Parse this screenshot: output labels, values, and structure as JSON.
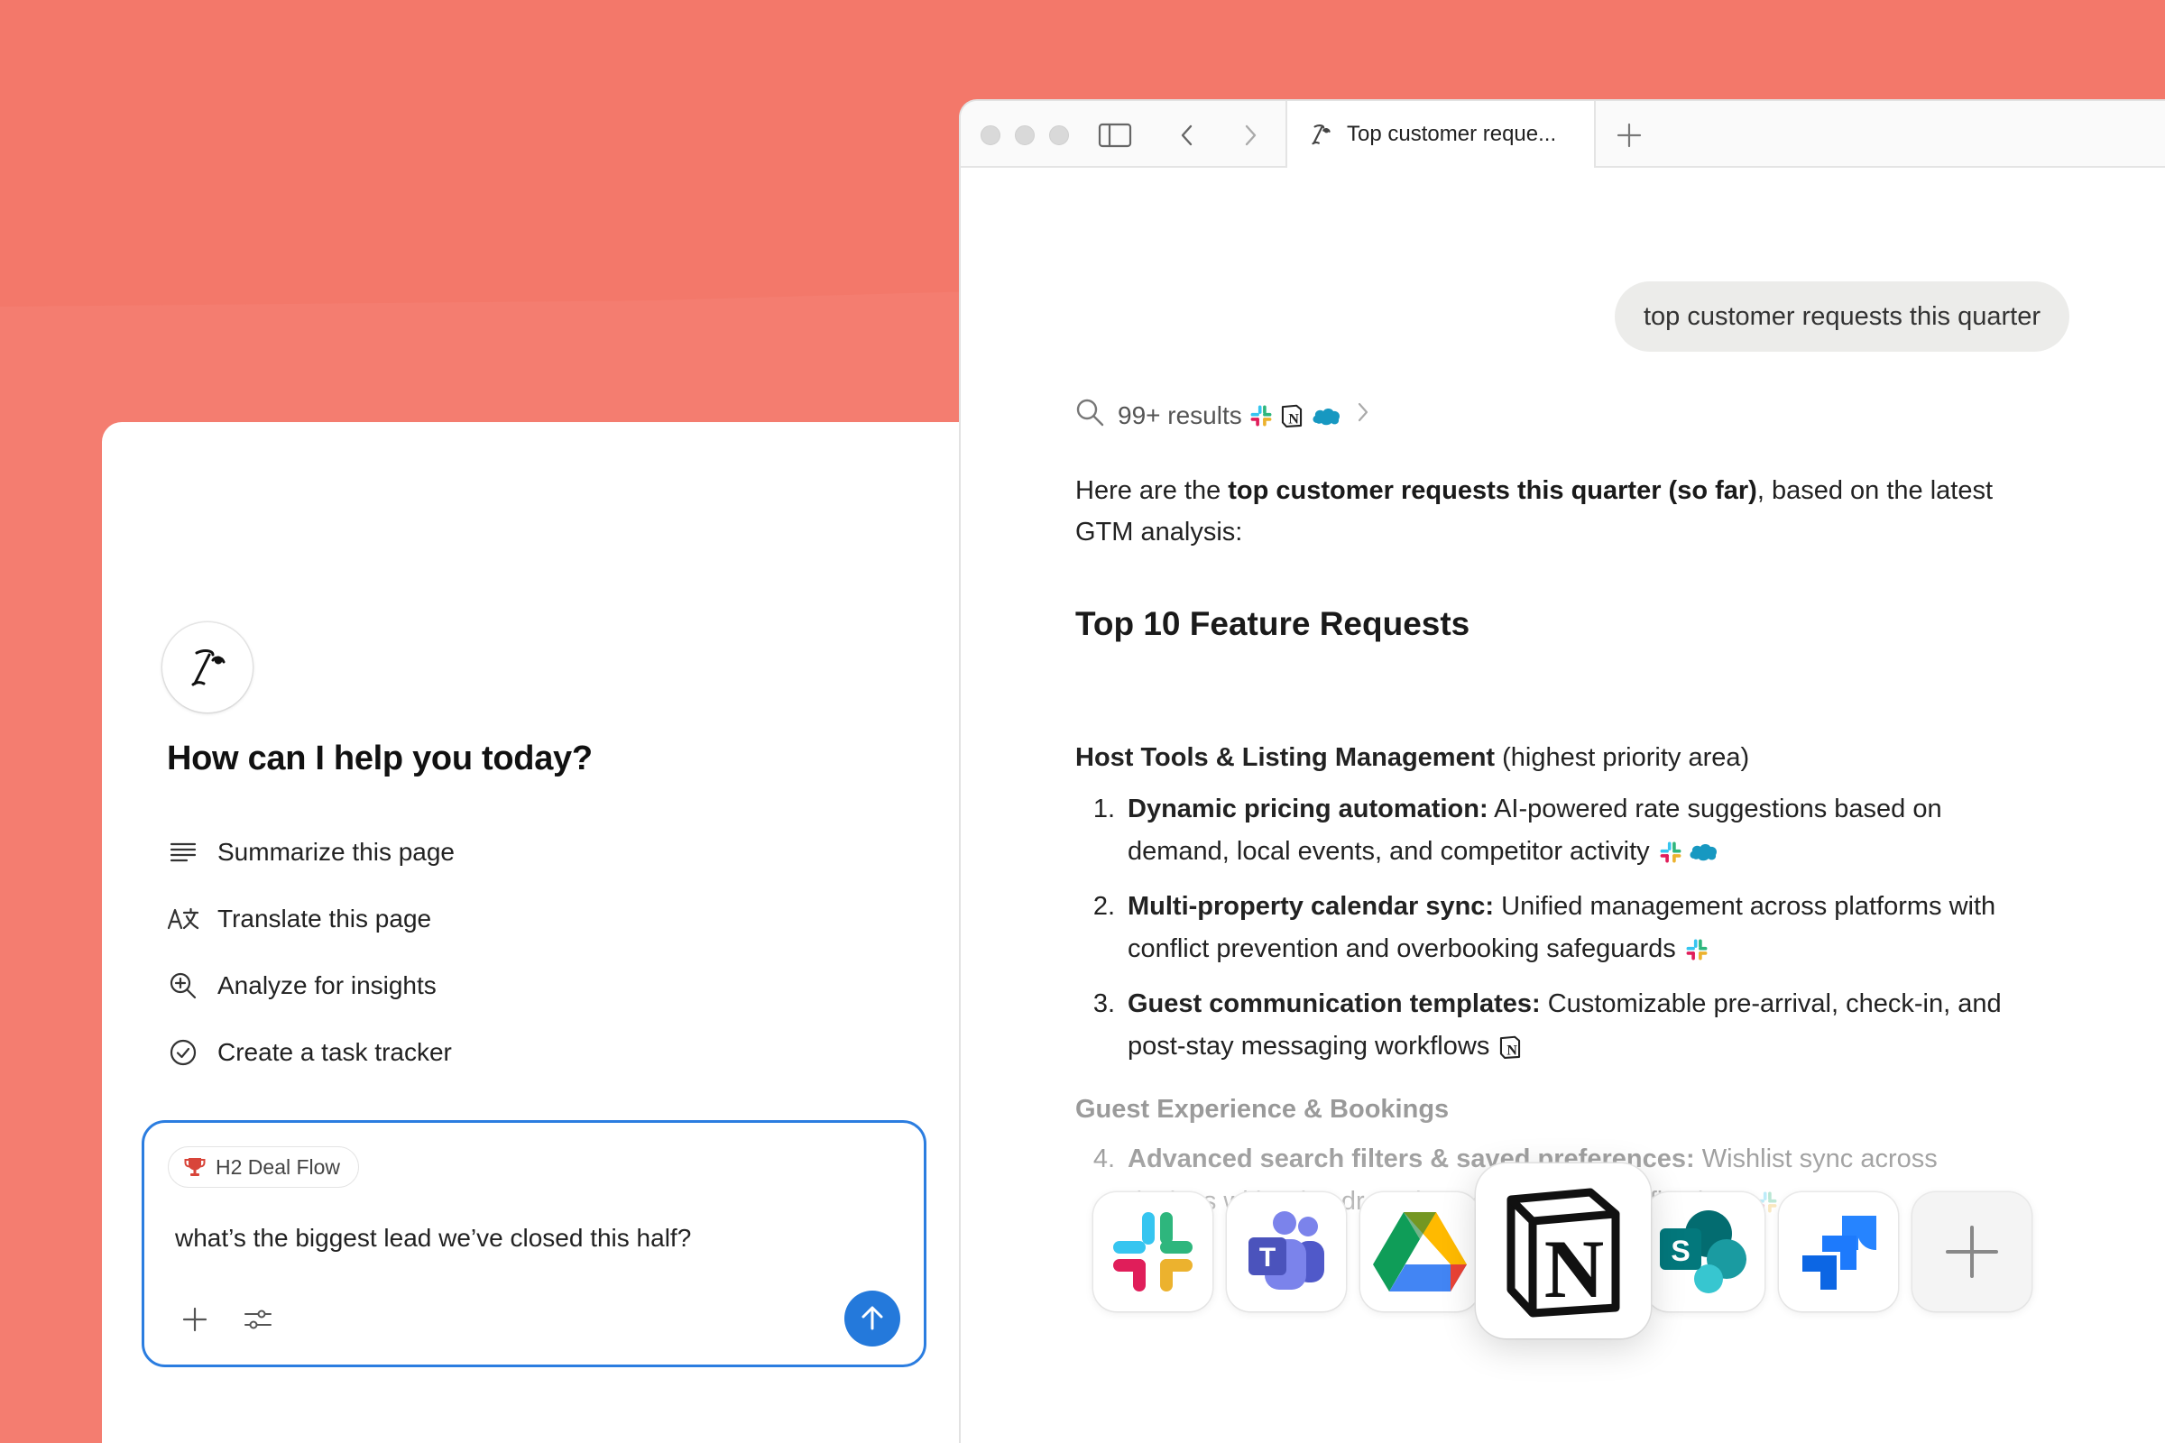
{
  "left_panel": {
    "greeting": "How can I help you today?",
    "suggestions": [
      {
        "label": "Summarize this page",
        "icon": "summarize-icon"
      },
      {
        "label": "Translate this page",
        "icon": "translate-icon"
      },
      {
        "label": "Analyze for insights",
        "icon": "analyze-icon"
      },
      {
        "label": "Create a task tracker",
        "icon": "task-tracker-icon"
      }
    ],
    "composer": {
      "context_chip": "H2 Deal Flow",
      "context_chip_icon": "trophy-icon",
      "text": "what’s the biggest lead we’ve closed this half?"
    }
  },
  "browser": {
    "tab_title": "Top customer reque...",
    "query": "top customer requests this quarter",
    "results_label": "99+ results",
    "result_sources": [
      "slack-icon",
      "notion-icon",
      "salesforce-icon"
    ],
    "intro": {
      "prefix": "Here are the ",
      "bold": "top customer requests this quarter (so far)",
      "suffix": ", based on the latest GTM analysis:"
    },
    "answer_title": "Top 10 Feature Requests",
    "sections": [
      {
        "title": "Host Tools & Listing Management",
        "note": " (highest priority area)"
      },
      {
        "title": "Guest Experience & Bookings",
        "note": ""
      }
    ],
    "requests": [
      {
        "num": "1.",
        "title": "Dynamic pricing automation:",
        "text": " AI-powered rate suggestions based on demand, local events, and competitor activity",
        "sources": [
          "slack-icon",
          "salesforce-icon"
        ]
      },
      {
        "num": "2.",
        "title": "Multi-property calendar sync:",
        "text": " Unified management across platforms with conflict prevention and overbooking safeguards",
        "sources": [
          "slack-icon"
        ]
      },
      {
        "num": "3.",
        "title": "Guest communication templates:",
        "text": " Customizable pre-arrival, check-in, and post-stay messaging workflows",
        "sources": [
          "notion-icon"
        ]
      },
      {
        "num": "4.",
        "title": "Advanced search filters & saved preferences:",
        "text": " Wishlist sync across devices with price drop alerts and instant notifications",
        "sources": [
          "slack-icon",
          "salesforce-icon"
        ]
      }
    ]
  },
  "dock": {
    "apps": [
      "slack-icon",
      "microsoft-teams-icon",
      "google-drive-icon",
      "notion-icon",
      "sharepoint-icon",
      "jira-icon",
      "add-integration-icon"
    ]
  },
  "colors": {
    "background": "#f47d70",
    "accent": "#2479db",
    "bubble": "#ececea"
  }
}
